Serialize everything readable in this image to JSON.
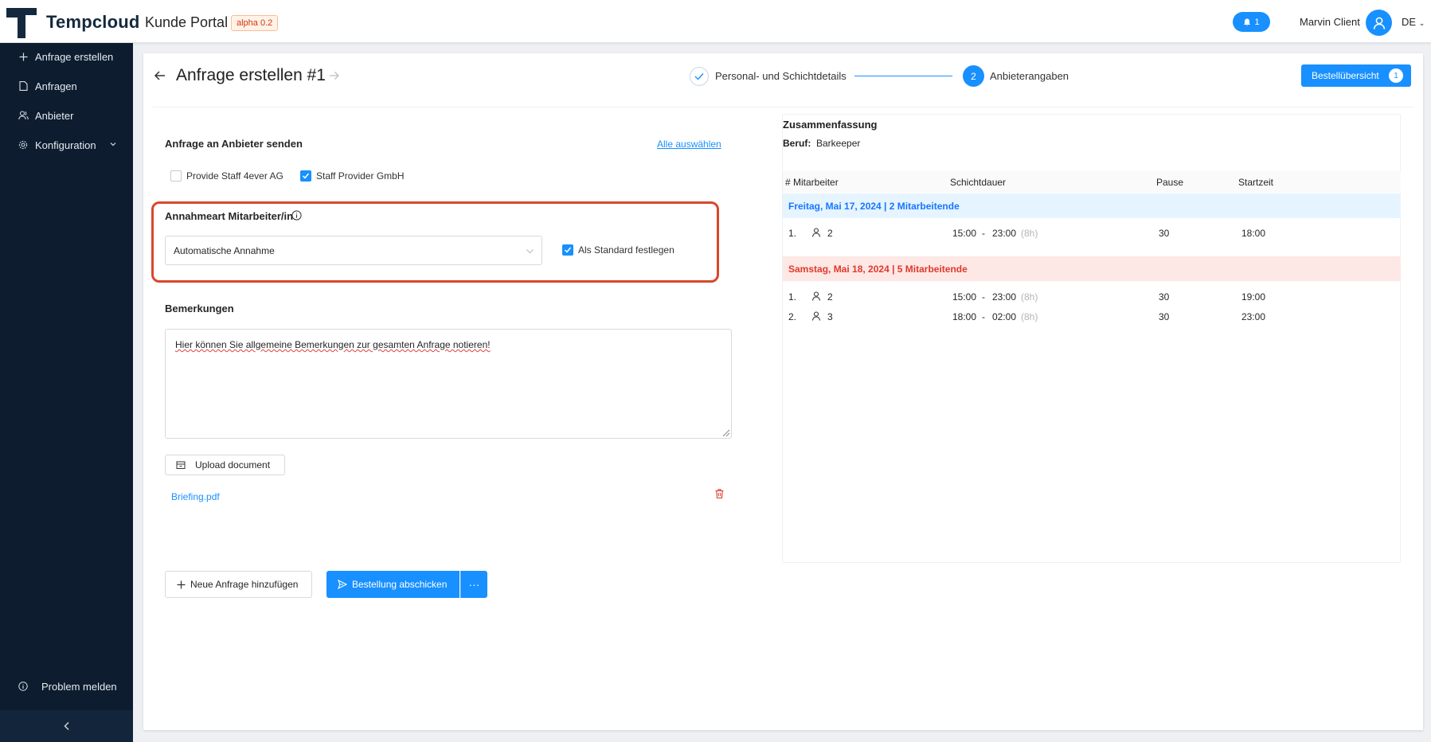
{
  "header": {
    "brand": "Tempcloud",
    "portal": "Kunde Portal",
    "version_badge": "alpha 0.2",
    "notification_count": "1",
    "user_name": "Marvin Client",
    "language": "DE"
  },
  "sidebar": {
    "items": [
      {
        "label": "Anfrage erstellen",
        "icon": "plus-icon"
      },
      {
        "label": "Anfragen",
        "icon": "document-icon"
      },
      {
        "label": "Anbieter",
        "icon": "users-icon"
      },
      {
        "label": "Konfiguration",
        "icon": "gear-icon"
      }
    ],
    "report_problem": "Problem melden"
  },
  "page": {
    "title": "Anfrage erstellen #1",
    "steps": [
      {
        "label": "Personal- und Schichtdetails",
        "status": "done"
      },
      {
        "number": "2",
        "label": "Anbieterangaben",
        "status": "active"
      }
    ],
    "order_overview": {
      "label": "Bestellübersicht",
      "count": "1"
    }
  },
  "form": {
    "send_label": "Anfrage an Anbieter senden",
    "select_all": "Alle auswählen",
    "providers": [
      {
        "label": "Provide Staff 4ever AG",
        "checked": false
      },
      {
        "label": "Staff Provider GmbH",
        "checked": true
      }
    ],
    "accept_label": "Annahmeart Mitarbeiter/in",
    "accept_value": "Automatische Annahme",
    "default_label": "Als Standard festlegen",
    "remarks_label": "Bemerkungen",
    "remarks_text": "Hier können Sie allgemeine Bemerkungen zur gesamten Anfrage notieren!",
    "upload_label": "Upload document",
    "file_name": "Briefing.pdf",
    "new_request": "Neue Anfrage hinzufügen",
    "submit": "Bestellung abschicken",
    "more": "···"
  },
  "summary": {
    "title": "Zusammenfassung",
    "beruf_key": "Beruf:",
    "beruf_value": "Barkeeper",
    "columns": [
      "# Mitarbeiter",
      "Schichtdauer",
      "Pause",
      "Startzeit"
    ],
    "groups": [
      {
        "title": "Freitag, Mai 17, 2024 | 2 Mitarbeitende",
        "color": "#1677ff",
        "rows": [
          {
            "nr": "1.",
            "staff": "2",
            "from": "15:00",
            "dash": "-",
            "to": "23:00",
            "hours": "(8h)",
            "pause": "30",
            "start": "18:00"
          }
        ]
      },
      {
        "title": "Samstag, Mai 18, 2024 | 5 Mitarbeitende",
        "color": "#e0392b",
        "rows": [
          {
            "nr": "1.",
            "staff": "2",
            "from": "15:00",
            "dash": "-",
            "to": "23:00",
            "hours": "(8h)",
            "pause": "30",
            "start": "19:00"
          },
          {
            "nr": "2.",
            "staff": "3",
            "from": "18:00",
            "dash": "-",
            "to": "02:00",
            "hours": "(8h)",
            "pause": "30",
            "start": "23:00"
          }
        ]
      }
    ]
  },
  "colors": {
    "primary": "#1890ff",
    "sidebar": "#0d1c2e",
    "highlight": "#d9472b"
  }
}
